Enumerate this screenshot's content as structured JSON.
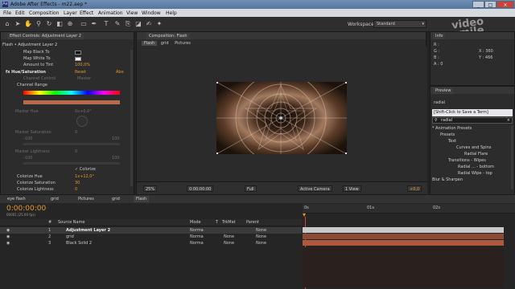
{
  "window": {
    "title": "Adobe After Effects - m22.aep *",
    "icon_label": "Ae",
    "buttons": [
      "_",
      "□",
      "×"
    ]
  },
  "menu": [
    "File",
    "Edit",
    "Composition",
    "Layer",
    "Effect",
    "Animation",
    "View",
    "Window",
    "Help"
  ],
  "toolbar": {
    "workspace_label": "Workspace:",
    "workspace_value": "Standard",
    "search_placeholder": "Search Help"
  },
  "watermark": {
    "line1": "video",
    "line2": "smile"
  },
  "effect_controls": {
    "tab": "Effect Controls: Adjustment Layer 2",
    "breadcrumb": "Flash • Adjustment Layer 2",
    "rows": [
      {
        "label": "Map Black To"
      },
      {
        "label": "Map White To"
      },
      {
        "label": "Amount to Tint",
        "value": "100,0%"
      }
    ],
    "effect_name": "Hue/Saturation",
    "reset": "Reset",
    "about": "Abo",
    "channel_control_label": "Channel Control",
    "channel_control_value": "Master",
    "channel_range": "Channel Range",
    "master_hue_label": "Master Hue",
    "master_hue_value": "0x+0,0°",
    "master_saturation_label": "Master Saturation",
    "master_saturation_value": "0",
    "sat_min": "-100",
    "sat_max": "100",
    "master_lightness_label": "Master Lightness",
    "master_lightness_value": "0",
    "light_min": "-100",
    "light_max": "100",
    "colorize_label": "Colorize",
    "colorize_hue_label": "Colorize Hue",
    "colorize_hue_value": "1x+12,0°",
    "colorize_sat_label": "Colorize Saturation",
    "colorize_sat_value": "30",
    "colorize_light_label": "Colorize Lightness",
    "colorize_light_value": "0"
  },
  "composition": {
    "tab": "Composition: Flash",
    "sub_tabs": [
      "Flash",
      "grid",
      "Pictures"
    ],
    "zoom": "25%",
    "timecode": "0:00:00:00",
    "resolution": "Full",
    "camera": "Active Camera",
    "views": "1 View",
    "exposure": "+0,0"
  },
  "info": {
    "tab": "Info",
    "r": "R :",
    "g": "G :",
    "b": "B :",
    "a": "A : 0",
    "x": "X : 360",
    "y": "Y : 466"
  },
  "preview": {
    "tab": "Preview",
    "query": "radial",
    "tooltip": "[Shift-Click to Save a Term]",
    "search_value": "radial",
    "tree": [
      {
        "label": "* Animation Presets",
        "indent": 0
      },
      {
        "label": "Presets",
        "indent": 1
      },
      {
        "label": "Text",
        "indent": 2
      },
      {
        "label": "Curves and Spins",
        "indent": 3
      },
      {
        "label": "Radial Flare",
        "indent": 4
      },
      {
        "label": "Transitions - Wipes",
        "indent": 2
      },
      {
        "label": "Radial ... - bottom",
        "indent": 3
      },
      {
        "label": "Radial Wipe - top",
        "indent": 3
      },
      {
        "label": "Blur & Sharpen",
        "indent": 0
      }
    ]
  },
  "timeline": {
    "tabs": [
      "eye flash",
      "grid",
      "Pictures",
      "grid",
      "Flash"
    ],
    "timecode": "0:00:00:00",
    "frame_info": "00001 (25.00 fps)",
    "search_placeholder": "",
    "columns": {
      "num": "#",
      "source": "Source Name",
      "mode": "Mode",
      "t": "T",
      "trkmat": "TrkMat",
      "parent": "Parent"
    },
    "ruler": [
      "0s",
      "01s",
      "02s"
    ],
    "layers": [
      {
        "num": "1",
        "name": "Adjustment Layer 2",
        "mode": "Norma",
        "trkmat": "",
        "parent": "None",
        "color": "#c9c9c9"
      },
      {
        "num": "2",
        "name": "grid",
        "mode": "Norma",
        "trkmat": "None",
        "parent": "None",
        "color": "#8a4c36"
      },
      {
        "num": "3",
        "name": "Black Solid 2",
        "mode": "Norma",
        "trkmat": "None",
        "parent": "None",
        "color": "#b0583e"
      }
    ]
  }
}
